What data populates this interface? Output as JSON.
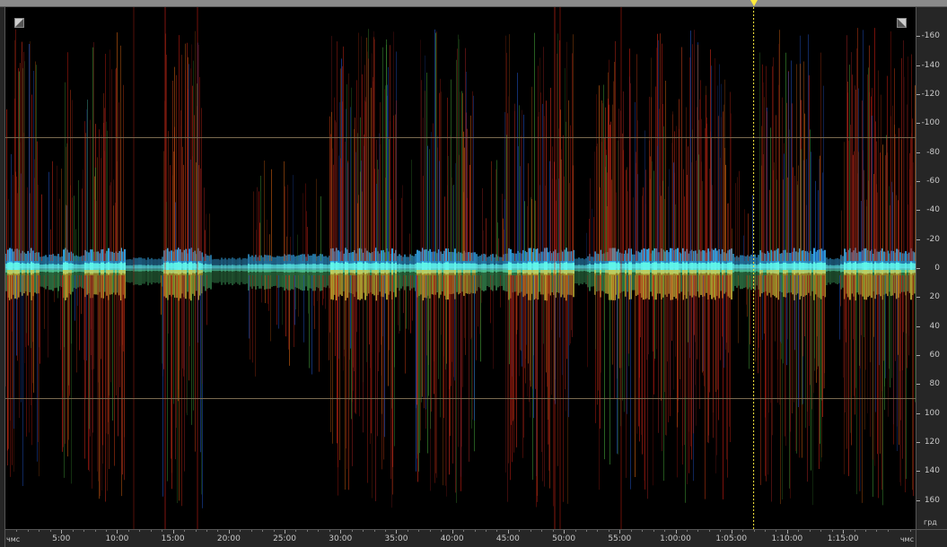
{
  "app": {
    "view_mode": "phase-spectrum-display"
  },
  "colors": {
    "background": "#000000",
    "ruler_bg": "#262626",
    "ruler_text": "#c8c8c8",
    "playhead": "#ffeb3b",
    "guide_line": "#7a6a50",
    "center_band": "#3ee6e6"
  },
  "vertical_axis": {
    "unit_label": "грд",
    "labels": [
      "-160",
      "-140",
      "-120",
      "-100",
      "-80",
      "-60",
      "-40",
      "-20",
      "0",
      "20",
      "40",
      "60",
      "80",
      "100",
      "120",
      "140",
      "160"
    ],
    "values": [
      -160,
      -140,
      -120,
      -100,
      -80,
      -60,
      -40,
      -20,
      0,
      20,
      40,
      60,
      80,
      100,
      120,
      140,
      160
    ],
    "range": [
      -180,
      180
    ],
    "guide_lines": [
      -90,
      90
    ]
  },
  "time_axis": {
    "unit_label_start": "чмс",
    "unit_label_end": "чмс",
    "labels": [
      "5:00",
      "10:00",
      "15:00",
      "20:00",
      "25:00",
      "30:00",
      "35:00",
      "40:00",
      "45:00",
      "50:00",
      "55:00",
      "1:00:00",
      "1:05:00",
      "1:10:00",
      "1:15:00"
    ],
    "values_seconds": [
      300,
      600,
      900,
      1200,
      1500,
      1800,
      2100,
      2400,
      2700,
      3000,
      3300,
      3600,
      3900,
      4200,
      4500
    ],
    "range_seconds": [
      0,
      4890
    ]
  },
  "playhead": {
    "position_seconds": 4020
  },
  "icons": {
    "corner_left": "zoom-corner-icon",
    "corner_right": "zoom-corner-icon",
    "playhead": "playhead-triangle-icon"
  }
}
